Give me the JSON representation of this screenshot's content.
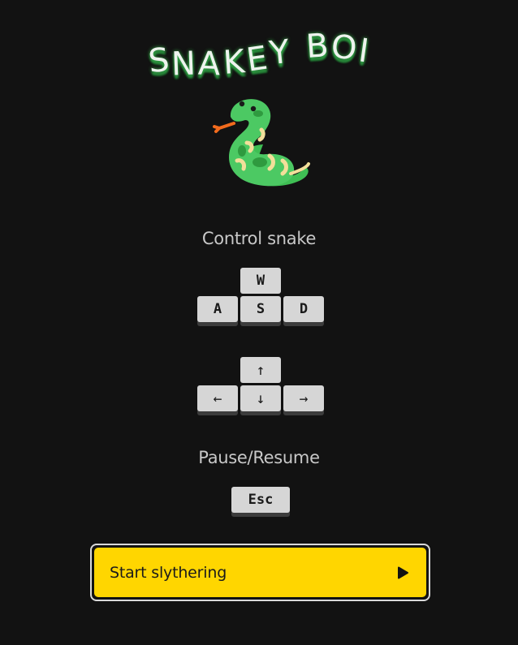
{
  "title": {
    "letters": [
      "S",
      "N",
      "A",
      "K",
      "E",
      "Y",
      " ",
      "B",
      "O",
      "I"
    ]
  },
  "logo": {
    "icon": "snake-icon"
  },
  "controls": {
    "heading": "Control snake",
    "wasd": {
      "up": "W",
      "left": "A",
      "down": "S",
      "right": "D"
    },
    "arrows": {
      "up": "↑",
      "left": "←",
      "down": "↓",
      "right": "→"
    }
  },
  "pause": {
    "heading": "Pause/Resume",
    "key": "Esc"
  },
  "start": {
    "label": "Start slythering",
    "icon": "play-icon"
  },
  "colors": {
    "background": "#121212",
    "button": "#ffd600",
    "key": "#d6d6d6",
    "title_glow": "#38b24a"
  }
}
